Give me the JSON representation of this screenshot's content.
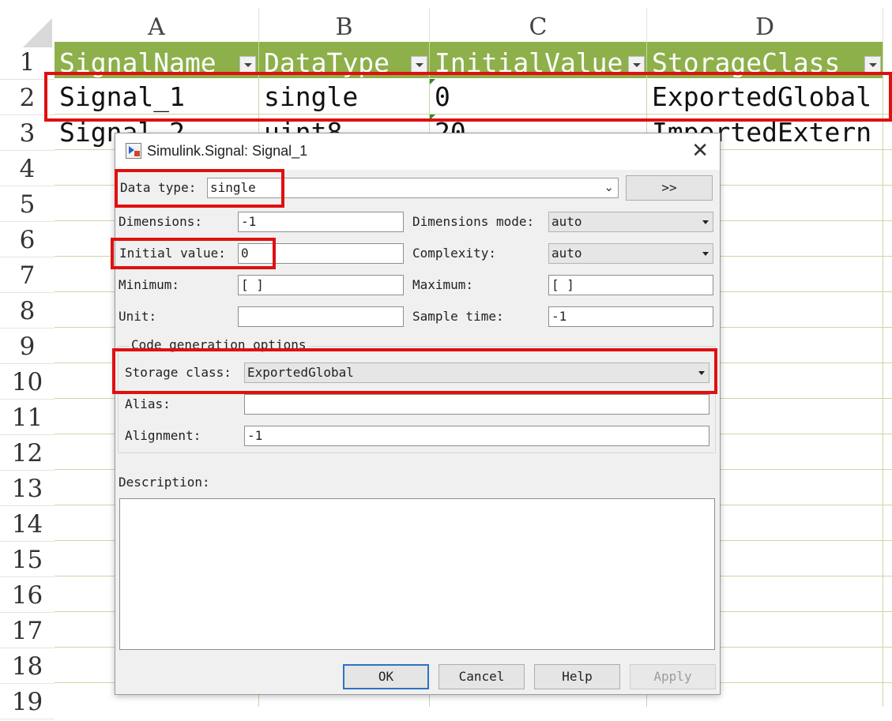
{
  "sheet": {
    "columns": [
      "A",
      "B",
      "C",
      "D"
    ],
    "rows": [
      "1",
      "2",
      "3",
      "4",
      "5",
      "6",
      "7",
      "8",
      "9",
      "10",
      "11",
      "12",
      "13",
      "14",
      "15",
      "16",
      "17",
      "18",
      "19"
    ],
    "header": [
      "SignalName",
      "DataType",
      "InitialValue",
      "StorageClass"
    ],
    "row2": [
      "Signal_1",
      "single",
      "0",
      "ExportedGlobal"
    ],
    "row3": [
      "Signal_2",
      "uint8",
      "20",
      "ImportedExtern"
    ],
    "header_color": "#8db04a"
  },
  "dialog": {
    "title": "Simulink.Signal: Signal_1",
    "close_symbol": "✕",
    "data_type_label": "Data type:",
    "data_type_value": "single",
    "expand_button": ">>",
    "dimensions_label": "Dimensions:",
    "dimensions_value": "-1",
    "dimensions_mode_label": "Dimensions mode:",
    "dimensions_mode_value": "auto",
    "initial_value_label": "Initial value:",
    "initial_value_value": "0",
    "complexity_label": "Complexity:",
    "complexity_value": "auto",
    "minimum_label": "Minimum:",
    "minimum_value": "[ ]",
    "maximum_label": "Maximum:",
    "maximum_value": "[ ]",
    "unit_label": "Unit:",
    "unit_value": "",
    "sample_time_label": "Sample time:",
    "sample_time_value": "-1",
    "codegen_title": "Code generation options",
    "storage_class_label": "Storage class:",
    "storage_class_value": "ExportedGlobal",
    "alias_label": "Alias:",
    "alias_value": "",
    "alignment_label": "Alignment:",
    "alignment_value": "-1",
    "description_label": "Description:",
    "description_value": "",
    "buttons": {
      "ok": "OK",
      "cancel": "Cancel",
      "help": "Help",
      "apply": "Apply"
    }
  },
  "highlight_color": "#e01010"
}
